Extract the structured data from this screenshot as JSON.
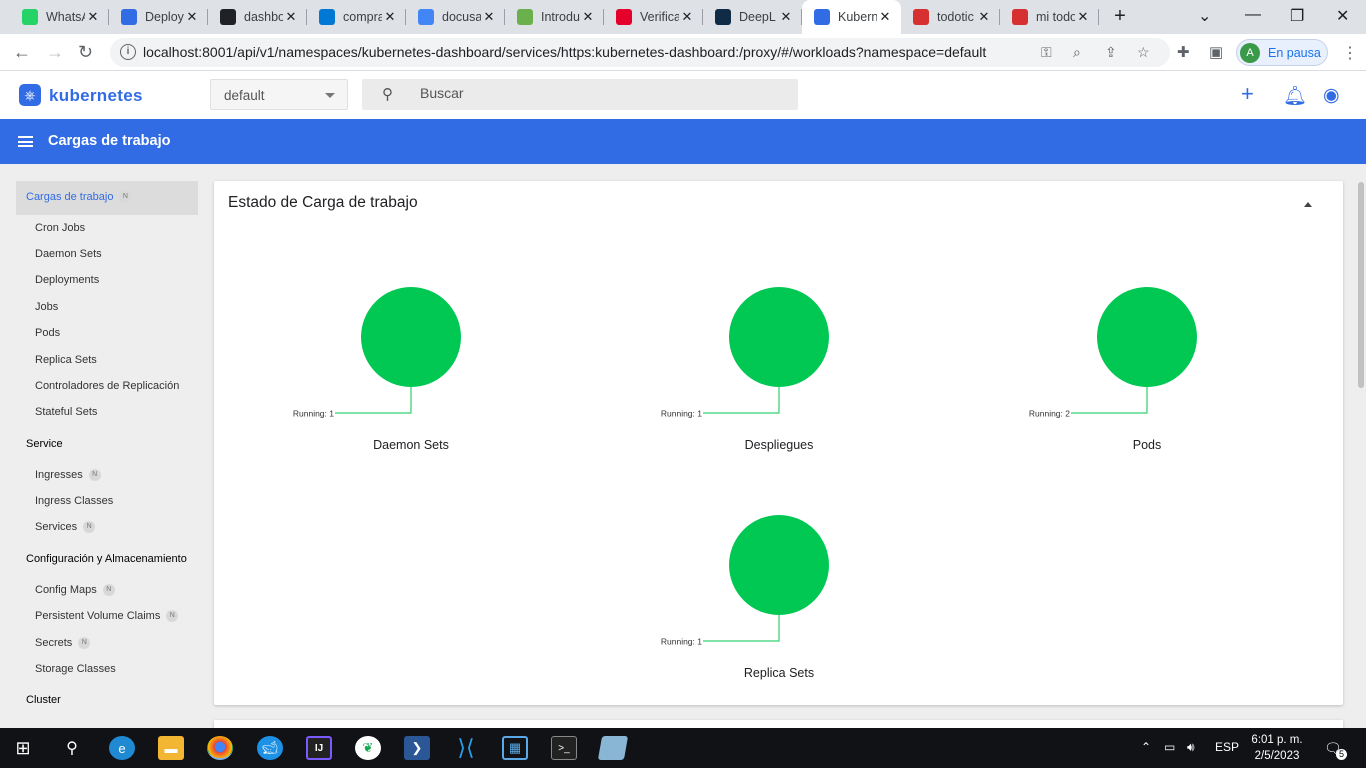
{
  "browser": {
    "tabs": [
      {
        "title": "WhatsApp",
        "icon": "whatsapp-icon",
        "color": "#25d366"
      },
      {
        "title": "Deploy",
        "icon": "kubernetes-icon",
        "color": "#326ce5"
      },
      {
        "title": "dashboard",
        "icon": "github-icon",
        "color": "#202124"
      },
      {
        "title": "comprar",
        "icon": "azure-icon",
        "color": "#0078d4"
      },
      {
        "title": "docusaurus",
        "icon": "google-icon",
        "color": "#4285f4"
      },
      {
        "title": "Introduction",
        "icon": "book-icon",
        "color": "#6ab04c"
      },
      {
        "title": "Verificar",
        "icon": "kfc-icon",
        "color": "#e4002b"
      },
      {
        "title": "DeepL",
        "icon": "deepl-icon",
        "color": "#0f2b46"
      },
      {
        "title": "Kubernetes",
        "icon": "kubernetes-icon",
        "color": "#326ce5",
        "active": true
      },
      {
        "title": "todotic",
        "icon": "todotic-icon",
        "color": "#d63031"
      },
      {
        "title": "mi todotic",
        "icon": "todotic-icon",
        "color": "#d63031"
      }
    ],
    "url": "localhost:8001/api/v1/namespaces/kubernetes-dashboard/services/https:kubernetes-dashboard:/proxy/#/workloads?namespace=default",
    "profile_initial": "A",
    "profile_label": "En pausa"
  },
  "header": {
    "brand": "kubernetes",
    "namespace": "default",
    "search_placeholder": "Buscar"
  },
  "titlebar": {
    "title": "Cargas de trabajo"
  },
  "sidebar": {
    "items": [
      {
        "label": "Cargas de trabajo",
        "type": "category",
        "selected": true,
        "badge": "N"
      },
      {
        "label": "Cron Jobs",
        "type": "item"
      },
      {
        "label": "Daemon Sets",
        "type": "item"
      },
      {
        "label": "Deployments",
        "type": "item"
      },
      {
        "label": "Jobs",
        "type": "item"
      },
      {
        "label": "Pods",
        "type": "item"
      },
      {
        "label": "Replica Sets",
        "type": "item"
      },
      {
        "label": "Controladores de Replicación",
        "type": "item"
      },
      {
        "label": "Stateful Sets",
        "type": "item"
      },
      {
        "label": "Service",
        "type": "category"
      },
      {
        "label": "Ingresses",
        "type": "item",
        "badge": "N"
      },
      {
        "label": "Ingress Classes",
        "type": "item"
      },
      {
        "label": "Services",
        "type": "item",
        "badge": "N"
      },
      {
        "label": "Configuración y Almacenamiento",
        "type": "category"
      },
      {
        "label": "Config Maps",
        "type": "item",
        "badge": "N"
      },
      {
        "label": "Persistent Volume Claims",
        "type": "item",
        "badge": "N"
      },
      {
        "label": "Secrets",
        "type": "item",
        "badge": "N"
      },
      {
        "label": "Storage Classes",
        "type": "item"
      },
      {
        "label": "Cluster",
        "type": "category"
      }
    ]
  },
  "card": {
    "title": "Estado de Carga de trabajo"
  },
  "chart_data": {
    "type": "pie",
    "color": "#00c853",
    "charts": [
      {
        "title": "Daemon Sets",
        "slices": [
          {
            "label": "Running",
            "value": 1
          }
        ]
      },
      {
        "title": "Despliegues",
        "slices": [
          {
            "label": "Running",
            "value": 1
          }
        ]
      },
      {
        "title": "Pods",
        "slices": [
          {
            "label": "Running",
            "value": 2
          }
        ]
      },
      {
        "title": "Replica Sets",
        "slices": [
          {
            "label": "Running",
            "value": 1
          }
        ]
      }
    ]
  },
  "taskbar": {
    "language": "ESP",
    "time": "6:01 p. m.",
    "date": "2/5/2023",
    "notifications": "5"
  }
}
